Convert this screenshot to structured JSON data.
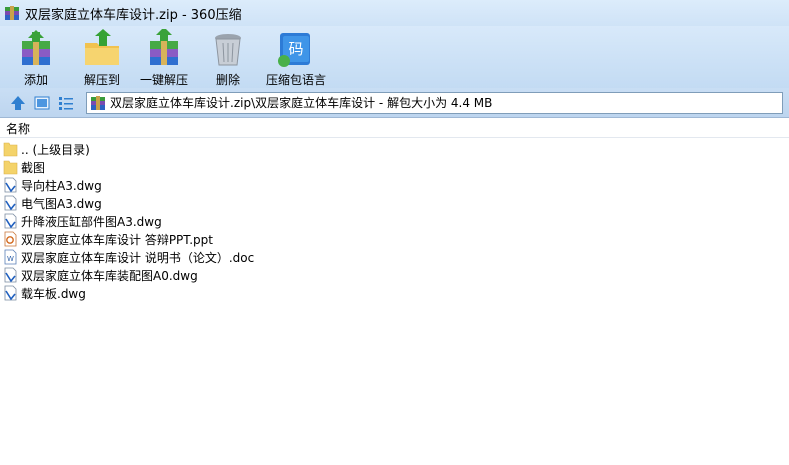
{
  "window": {
    "title": "双层家庭立体车库设计.zip - 360压缩"
  },
  "toolbar": {
    "items": [
      {
        "label": "添加",
        "icon": "add-archive-icon"
      },
      {
        "label": "解压到",
        "icon": "extract-to-icon"
      },
      {
        "label": "一键解压",
        "icon": "one-click-extract-icon"
      },
      {
        "label": "删除",
        "icon": "trash-icon"
      },
      {
        "label": "压缩包语言",
        "icon": "archive-language-icon"
      }
    ],
    "lang_glyph": "码"
  },
  "address": {
    "path": "双层家庭立体车库设计.zip\\双层家庭立体车库设计 - 解包大小为 4.4 MB"
  },
  "list": {
    "header": "名称",
    "items": [
      {
        "name": ".. (上级目录)",
        "type": "folder"
      },
      {
        "name": "截图",
        "type": "folder"
      },
      {
        "name": "导向柱A3.dwg",
        "type": "dwg"
      },
      {
        "name": "电气图A3.dwg",
        "type": "dwg"
      },
      {
        "name": "升降液压缸部件图A3.dwg",
        "type": "dwg"
      },
      {
        "name": "双层家庭立体车库设计 答辩PPT.ppt",
        "type": "ppt"
      },
      {
        "name": "双层家庭立体车库设计 说明书（论文）.doc",
        "type": "doc"
      },
      {
        "name": "双层家庭立体车库装配图A0.dwg",
        "type": "dwg"
      },
      {
        "name": "载车板.dwg",
        "type": "dwg"
      }
    ]
  },
  "colors": {
    "chrome": "#cfe3f7",
    "accent_blue": "#2f7fd0",
    "folder": "#f4d36a"
  }
}
